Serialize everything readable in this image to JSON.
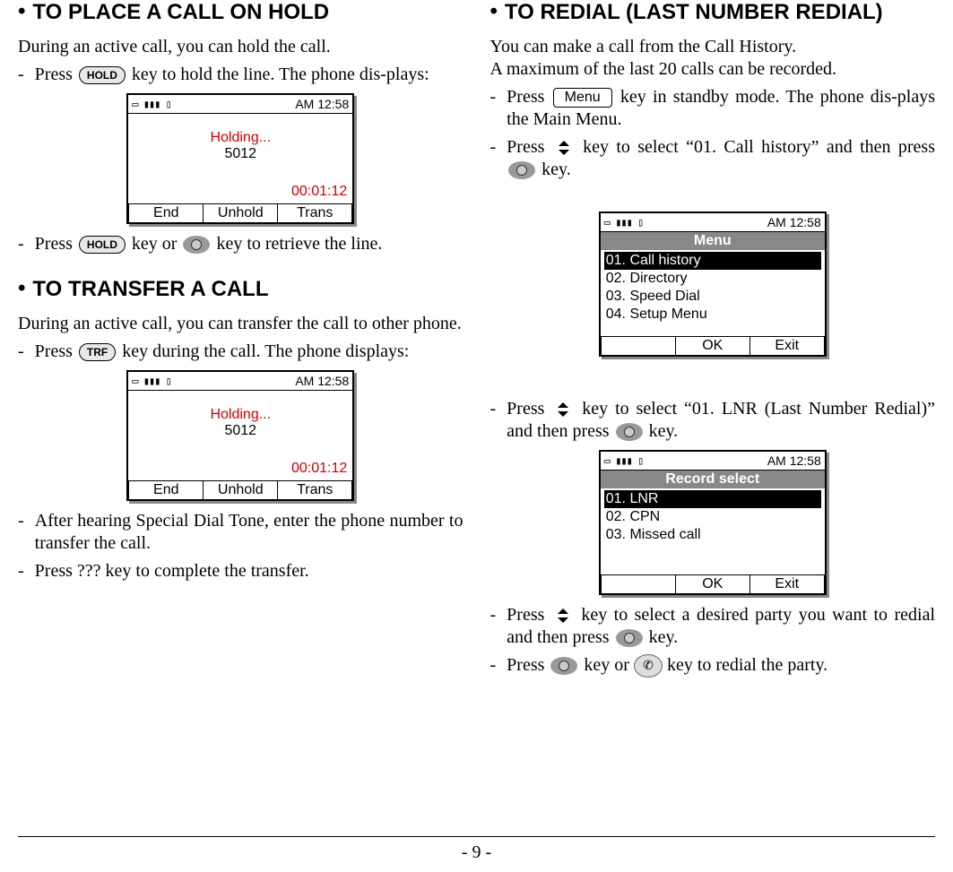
{
  "left": {
    "heading_hold": "TO PLACE A CALL ON HOLD",
    "hold_intro": "During an active call, you can hold the call.",
    "hold_press1a": "Press ",
    "hold_key_label": "HOLD",
    "hold_press1b": " key to hold the line. The phone dis-plays:",
    "hold_press2a": "Press ",
    "hold_press2b": " key or ",
    "hold_press2c": " key to retrieve the line.",
    "heading_transfer": "TO TRANSFER A CALL",
    "transfer_intro": "During an active call, you can transfer the call to other phone.",
    "trf_press1a": "Press ",
    "trf_key_label": "TRF",
    "trf_press1b": " key during the call. The phone displays:",
    "trf_after": "After hearing Special Dial Tone, enter the phone number to transfer the call.",
    "trf_complete": "Press  ???   key to complete the transfer."
  },
  "right": {
    "heading_redial": "TO REDIAL (LAST NUMBER REDIAL)",
    "redial_intro1": "You can make a call from the Call History.",
    "redial_intro2": "A maximum of the last 20 calls can be recorded.",
    "redial_press1a": "Press ",
    "menu_key_label": "Menu",
    "redial_press1b": " key in standby mode. The phone dis-plays the Main Menu.",
    "redial_press2a": "Press ",
    "redial_press2b": " key to select “01. Call history” and then press ",
    "redial_press2c": " key.",
    "redial_press3a": "Press ",
    "redial_press3b": " key to select “01. LNR (Last Number Redial)”  and then press ",
    "redial_press3c": " key.",
    "redial_press4a": "Press ",
    "redial_press4b": " key to select a desired party you want to redial and then press ",
    "redial_press4c": " key.",
    "redial_press5a": "Press ",
    "redial_press5b": " key or ",
    "redial_press5c": "   key to redial the party."
  },
  "screens": {
    "status_icons": "▭ ▮▮▮ ▯",
    "time": "AM 12:58",
    "holding": "Holding...",
    "ext": "5012",
    "timer": "00:01:12",
    "soft_end": "End",
    "soft_unhold": "Unhold",
    "soft_trans": "Trans",
    "menu_title": "Menu",
    "menu_items": [
      "01. Call history",
      "02. Directory",
      "03. Speed Dial",
      "04. Setup Menu"
    ],
    "rec_title": "Record select",
    "rec_items": [
      "01. LNR",
      "02. CPN",
      "03. Missed call"
    ],
    "soft_blank": "",
    "soft_ok": "OK",
    "soft_exit": "Exit"
  },
  "footer": "- 9 -"
}
